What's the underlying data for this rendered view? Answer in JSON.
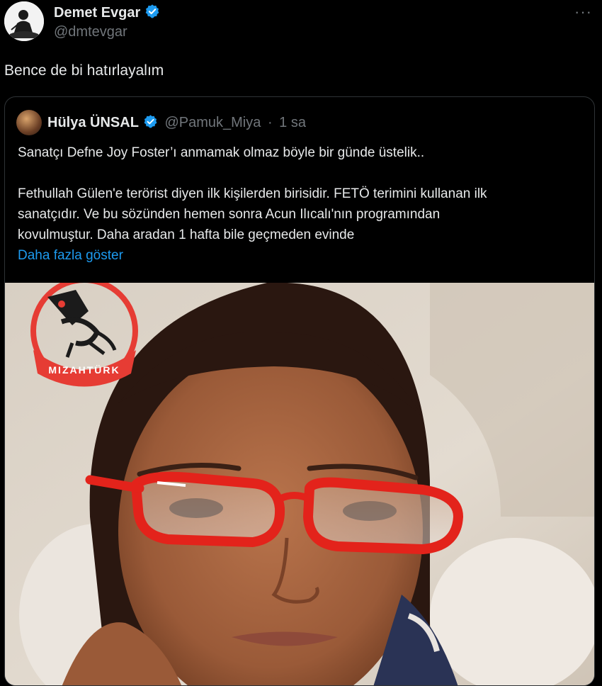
{
  "tweet": {
    "author_name": "Demet Evgar",
    "author_handle": "@dmtevgar",
    "more_icon": "more-options-icon",
    "text": "Bence de bi hatırlayalım"
  },
  "quote": {
    "author_name": "Hülya ÜNSAL",
    "author_handle": "@Pamuk_Miya",
    "separator": "·",
    "time": "1 sa",
    "lines": [
      "Sanatçı  Defne Joy Foster’ı anmamak olmaz böyle bir günde üstelik..",
      "Fethullah Gülen'e terörist diyen ilk kişilerden birisidir. FETÖ terimini kullanan ilk",
      "sanatçıdır. Ve bu sözünden hemen sonra Acun Ilıcalı'nın programından",
      "kovulmuştur. Daha aradan 1 hafta bile geçmeden evinde"
    ],
    "show_more": "Daha fazla göster",
    "watermark": "MIZAHTÜRK"
  },
  "colors": {
    "background": "#000000",
    "text": "#e7e9ea",
    "muted": "#71767b",
    "link": "#1d9bf0",
    "verified": "#1d9bf0",
    "glasses": "#e3231b"
  }
}
